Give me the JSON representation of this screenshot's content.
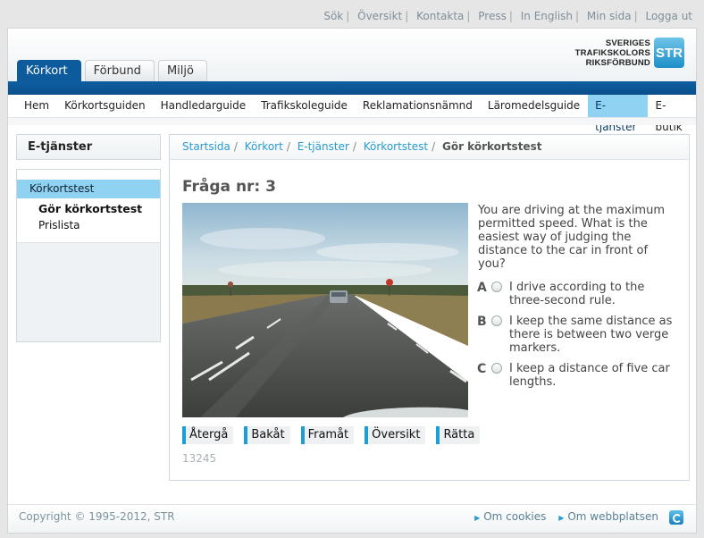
{
  "top_links": [
    "Sök",
    "Översikt",
    "Kontakta",
    "Press",
    "In English",
    "Min sida",
    "Logga ut"
  ],
  "logo": {
    "line1": "SVERIGES",
    "line2": "TRAFIKSKOLORS",
    "line3": "RIKSFÖRBUND",
    "badge": "STR",
    "badge_icon": "str-logo-icon"
  },
  "tabs": [
    {
      "label": "Körkort"
    },
    {
      "label": "Förbund"
    },
    {
      "label": "Miljö"
    }
  ],
  "main_nav": [
    {
      "label": "Hem"
    },
    {
      "label": "Körkortsguiden"
    },
    {
      "label": "Handledarguide"
    },
    {
      "label": "Trafikskoleguide"
    },
    {
      "label": "Reklamationsnämnd"
    },
    {
      "label": "Läromedelsguide"
    },
    {
      "label": "E-tjänster"
    },
    {
      "label": "E-butik"
    }
  ],
  "sidebar": {
    "title": "E-tjänster",
    "section": "Körkortstest",
    "items": [
      {
        "label": "Gör körkortstest"
      },
      {
        "label": "Prislista"
      }
    ]
  },
  "breadcrumb": {
    "links": [
      "Startsida",
      "Körkort",
      "E-tjänster",
      "Körkortstest"
    ],
    "current": "Gör körkortstest"
  },
  "quiz": {
    "title": "Fråga nr: 3",
    "question": "You are driving at the maximum permitted speed. What is the easiest way of judging the distance to the car in front of you?",
    "answers": [
      {
        "letter": "A",
        "text": "I drive according to the three-second rule."
      },
      {
        "letter": "B",
        "text": "I keep the same distance as there is between two verge markers."
      },
      {
        "letter": "C",
        "text": "I keep a distance of five car lengths."
      }
    ],
    "buttons": [
      {
        "label": "Återgå"
      },
      {
        "label": "Bakåt"
      },
      {
        "label": "Framåt"
      },
      {
        "label": "Översikt"
      },
      {
        "label": "Rätta"
      }
    ],
    "question_id": "13245"
  },
  "footer": {
    "copyright": "Copyright © 1995-2012, STR",
    "links": [
      "Om cookies",
      "Om webbplatsen"
    ],
    "icon": "teamviewer-icon"
  },
  "colors": {
    "brand_blue": "#0d5a9c",
    "accent_light_blue": "#8fd2f2",
    "link_blue": "#2a9bd0",
    "button_accent": "#1b9ed6"
  }
}
